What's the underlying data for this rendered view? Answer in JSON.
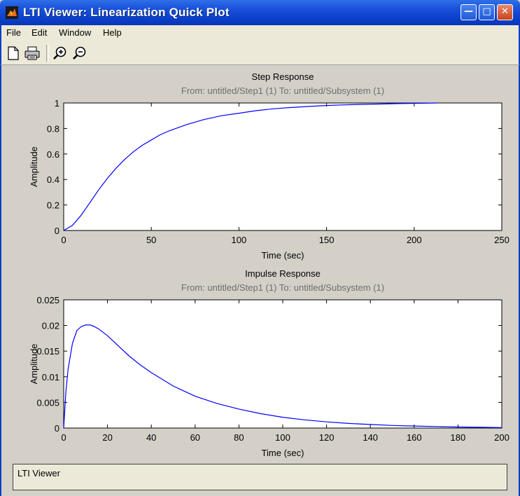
{
  "window": {
    "title": "LTI Viewer: Linearization Quick Plot",
    "minimize_icon": "minimize-icon",
    "maximize_icon": "maximize-icon",
    "close_icon": "close-icon"
  },
  "menu": {
    "items": [
      "File",
      "Edit",
      "Window",
      "Help"
    ]
  },
  "toolbar": {
    "tools": [
      "new-document-icon",
      "print-icon",
      "zoom-in-icon",
      "zoom-out-icon"
    ]
  },
  "status": {
    "text": "LTI Viewer"
  },
  "chart_data": [
    {
      "type": "line",
      "title": "Step Response",
      "subtitle": "From: untitled/Step1 (1)  To: untitled/Subsystem (1)",
      "xlabel": "Time (sec)",
      "ylabel": "Amplitude",
      "xlim": [
        0,
        250
      ],
      "ylim": [
        0,
        1
      ],
      "xticks": [
        "0",
        "50",
        "100",
        "150",
        "200",
        "250"
      ],
      "yticks": [
        "0",
        "0.2",
        "0.4",
        "0.6",
        "0.8",
        "1"
      ],
      "reference_line": 1,
      "series": [
        {
          "color": "#0000ff",
          "x": [
            0,
            5,
            10,
            15,
            20,
            25,
            30,
            35,
            40,
            45,
            50,
            55,
            60,
            70,
            80,
            90,
            100,
            110,
            120,
            130,
            140,
            150,
            160,
            170,
            180,
            190,
            200,
            213
          ],
          "y": [
            0,
            0.04,
            0.12,
            0.22,
            0.32,
            0.41,
            0.49,
            0.56,
            0.62,
            0.67,
            0.71,
            0.75,
            0.78,
            0.83,
            0.87,
            0.9,
            0.92,
            0.94,
            0.955,
            0.965,
            0.973,
            0.98,
            0.985,
            0.989,
            0.992,
            0.995,
            0.997,
            1.0
          ]
        }
      ]
    },
    {
      "type": "line",
      "title": "Impulse Response",
      "subtitle": "From: untitled/Step1 (1)  To: untitled/Subsystem (1)",
      "xlabel": "Time (sec)",
      "ylabel": "Amplitude",
      "xlim": [
        0,
        200
      ],
      "ylim": [
        0,
        0.025
      ],
      "xticks": [
        "0",
        "20",
        "40",
        "60",
        "80",
        "100",
        "120",
        "140",
        "160",
        "180",
        "200"
      ],
      "yticks": [
        "0",
        "0.005",
        "0.01",
        "0.015",
        "0.02",
        "0.025"
      ],
      "reference_line": 0,
      "series": [
        {
          "color": "#0000ff",
          "x": [
            0,
            1,
            2,
            4,
            6,
            8,
            10,
            12,
            14,
            16,
            20,
            25,
            30,
            35,
            40,
            50,
            60,
            70,
            80,
            90,
            100,
            110,
            120,
            130,
            140,
            150,
            160,
            170,
            180,
            190,
            200
          ],
          "y": [
            0,
            0.007,
            0.0115,
            0.0165,
            0.019,
            0.0198,
            0.0201,
            0.0201,
            0.0198,
            0.0193,
            0.018,
            0.016,
            0.014,
            0.0123,
            0.0108,
            0.0082,
            0.0062,
            0.0048,
            0.0037,
            0.0028,
            0.0021,
            0.0016,
            0.0012,
            0.0009,
            0.0007,
            0.0005,
            0.0004,
            0.0003,
            0.0002,
            0.00015,
            0.0001
          ]
        }
      ]
    }
  ]
}
